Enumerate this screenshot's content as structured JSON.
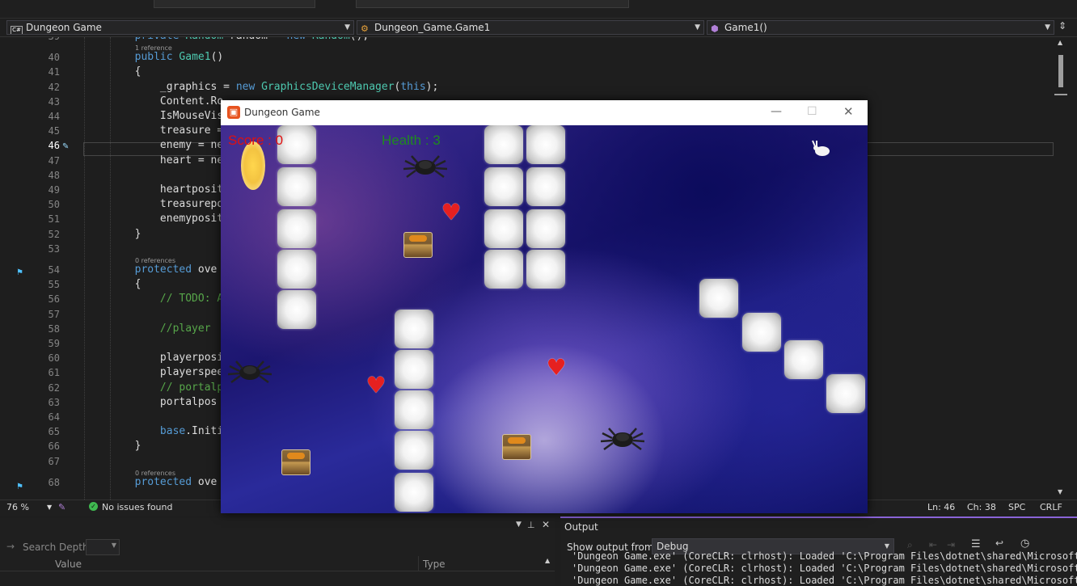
{
  "nav": {
    "project": "Dungeon Game",
    "class": "Dungeon_Game.Game1",
    "member": "Game1()"
  },
  "editor": {
    "lines": [
      {
        "n": "39",
        "code": "        private Random random = new Random();"
      },
      {
        "n": "40",
        "code": "        public Game1()",
        "ref": "1 reference"
      },
      {
        "n": "41",
        "code": "        {"
      },
      {
        "n": "42",
        "code": "            _graphics = new GraphicsDeviceManager(this);"
      },
      {
        "n": "43",
        "code": "            Content.Ro"
      },
      {
        "n": "44",
        "code": "            IsMouseVis"
      },
      {
        "n": "45",
        "code": "            treasure ="
      },
      {
        "n": "46",
        "code": "            enemy = ne"
      },
      {
        "n": "47",
        "code": "            heart = ne"
      },
      {
        "n": "48",
        "code": ""
      },
      {
        "n": "49",
        "code": "            heartposit"
      },
      {
        "n": "50",
        "code": "            treasurepo"
      },
      {
        "n": "51",
        "code": "            enemyposit"
      },
      {
        "n": "52",
        "code": "        }"
      },
      {
        "n": "53",
        "code": ""
      },
      {
        "n": "54",
        "code": "        protected ove",
        "ref": "0 references"
      },
      {
        "n": "55",
        "code": "        {"
      },
      {
        "n": "56",
        "code": "            // TODO: A"
      },
      {
        "n": "57",
        "code": ""
      },
      {
        "n": "58",
        "code": "            //player"
      },
      {
        "n": "59",
        "code": ""
      },
      {
        "n": "60",
        "code": "            playerposi"
      },
      {
        "n": "61",
        "code": "            playerspee"
      },
      {
        "n": "62",
        "code": "            // portalp"
      },
      {
        "n": "63",
        "code": "            portalpos"
      },
      {
        "n": "64",
        "code": ""
      },
      {
        "n": "65",
        "code": "            base.Initi"
      },
      {
        "n": "66",
        "code": "        }"
      },
      {
        "n": "67",
        "code": ""
      },
      {
        "n": "68",
        "code": "        protected ove",
        "ref": "0 references"
      }
    ]
  },
  "status": {
    "zoom": "76 %",
    "issues": "No issues found",
    "ln": "Ln: 46",
    "ch": "Ch: 38",
    "spc": "SPC",
    "crlf": "CRLF"
  },
  "left_panel": {
    "search_depth_label": "Search Depth:",
    "col_value": "Value",
    "col_type": "Type"
  },
  "output": {
    "title": "Output",
    "show_label": "Show output from:",
    "source": "Debug",
    "lines": [
      "'Dungeon Game.exe' (CoreCLR: clrhost): Loaded 'C:\\Program Files\\dotnet\\shared\\Microsoft.N",
      "'Dungeon Game.exe' (CoreCLR: clrhost): Loaded 'C:\\Program Files\\dotnet\\shared\\Microsoft.N",
      "'Dungeon Game.exe' (CoreCLR: clrhost): Loaded 'C:\\Program Files\\dotnet\\shared\\Microsoft.N"
    ]
  },
  "game": {
    "title": "Dungeon Game",
    "score_label": "Score : 0",
    "health_label": "Health : 3",
    "colors": {
      "score": "#e01010",
      "health": "#1f8a1f"
    }
  }
}
